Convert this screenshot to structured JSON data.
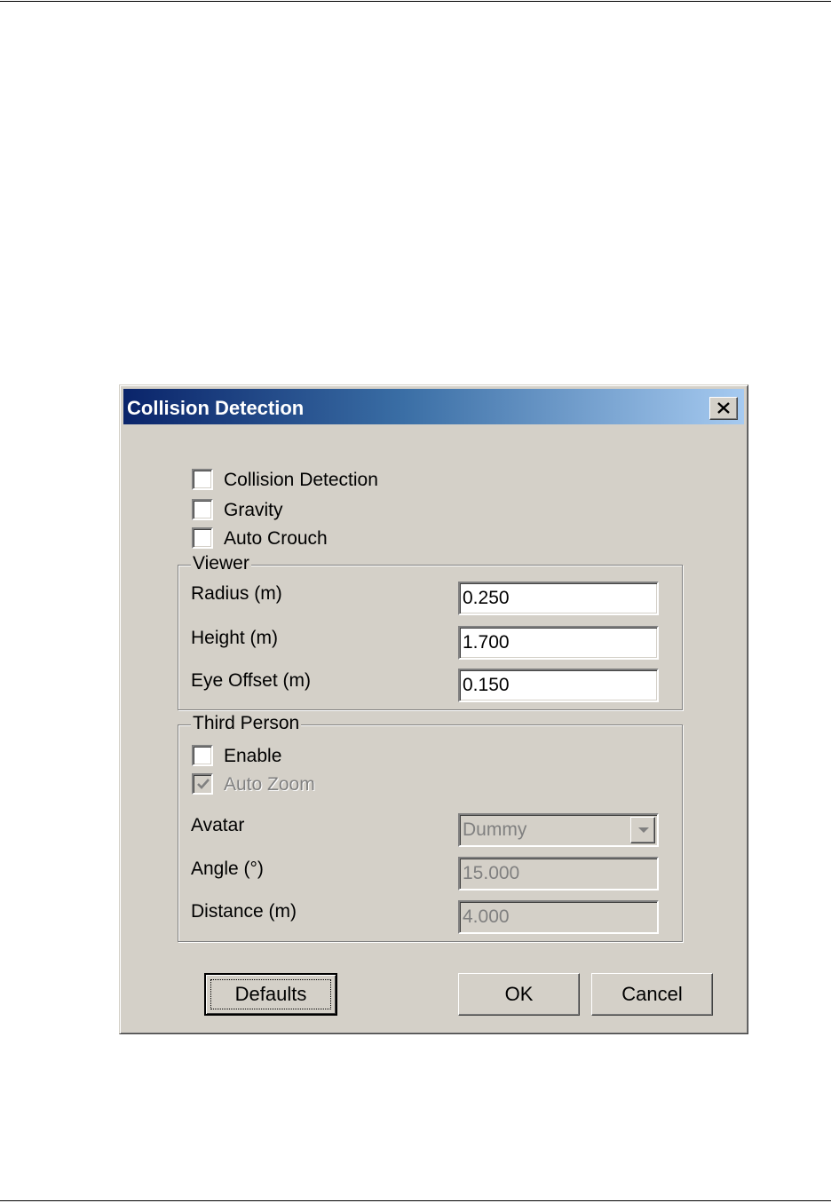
{
  "dialog": {
    "title": "Collision Detection",
    "close_icon": "close-x-icon"
  },
  "options": {
    "collision_detection": {
      "label": "Collision Detection",
      "checked": false
    },
    "gravity": {
      "label": "Gravity",
      "checked": false
    },
    "auto_crouch": {
      "label": "Auto Crouch",
      "checked": false
    }
  },
  "viewer": {
    "title": "Viewer",
    "radius": {
      "label": "Radius (m)",
      "value": "0.250"
    },
    "height": {
      "label": "Height (m)",
      "value": "1.700"
    },
    "eye_offset": {
      "label": "Eye Offset (m)",
      "value": "0.150"
    }
  },
  "third_person": {
    "title": "Third Person",
    "enable": {
      "label": "Enable",
      "checked": false
    },
    "auto_zoom": {
      "label": "Auto Zoom",
      "checked": true,
      "disabled": true
    },
    "avatar": {
      "label": "Avatar",
      "value": "Dummy",
      "icon": "chevron-down-icon"
    },
    "angle": {
      "label": "Angle (°)",
      "value": "15.000"
    },
    "distance": {
      "label": "Distance (m)",
      "value": "4.000"
    }
  },
  "buttons": {
    "defaults": "Defaults",
    "ok": "OK",
    "cancel": "Cancel"
  },
  "colors": {
    "dialog_face": "#d4d0c8",
    "title_start": "#0a246a",
    "title_end": "#a6caf0",
    "disabled_text": "#808080"
  }
}
